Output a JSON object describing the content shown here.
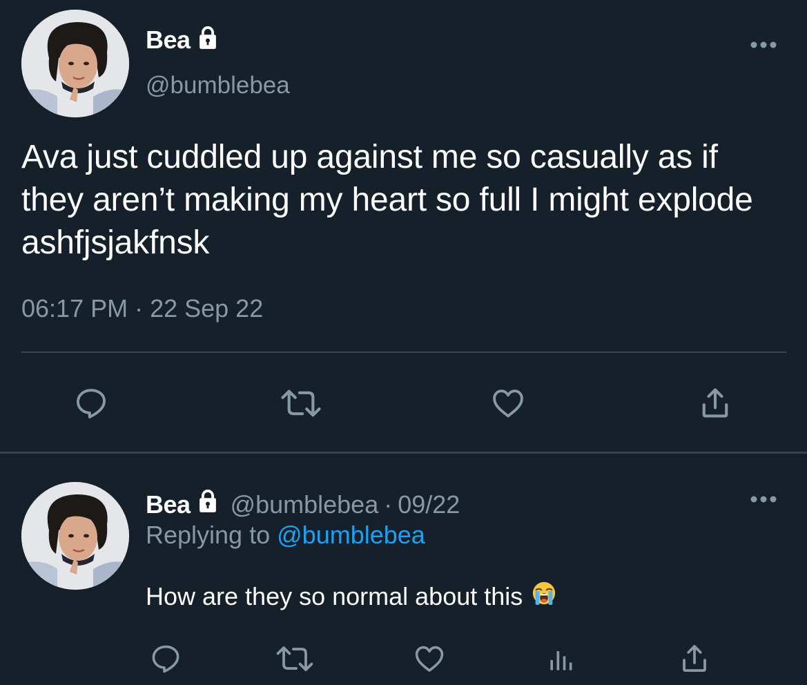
{
  "main_tweet": {
    "display_name": "Bea",
    "handle": "@bumblebea",
    "text": "Ava just cuddled up against me so casually as if they aren’t making my heart so full I might explode ashfjsjakfnsk",
    "timestamp": "06:17 PM · 22 Sep 22",
    "icons": [
      "lock-icon",
      "more-icon",
      "reply-icon",
      "retweet-icon",
      "like-icon",
      "share-icon"
    ]
  },
  "reply_tweet": {
    "display_name": "Bea",
    "handle": "@bumblebea",
    "separator": "·",
    "date": "09/22",
    "replying_prefix": "Replying to",
    "replying_to": "@bumblebea",
    "text": "How are they so normal about this",
    "emoji": "loudly-crying-face",
    "icons": [
      "lock-icon",
      "more-icon",
      "reply-icon",
      "retweet-icon",
      "like-icon",
      "analytics-icon",
      "share-icon"
    ]
  },
  "colors": {
    "background": "#15202b",
    "primary_text": "#ffffff",
    "secondary_text": "#8899a6",
    "link": "#1da1f2",
    "divider": "#38444d"
  }
}
